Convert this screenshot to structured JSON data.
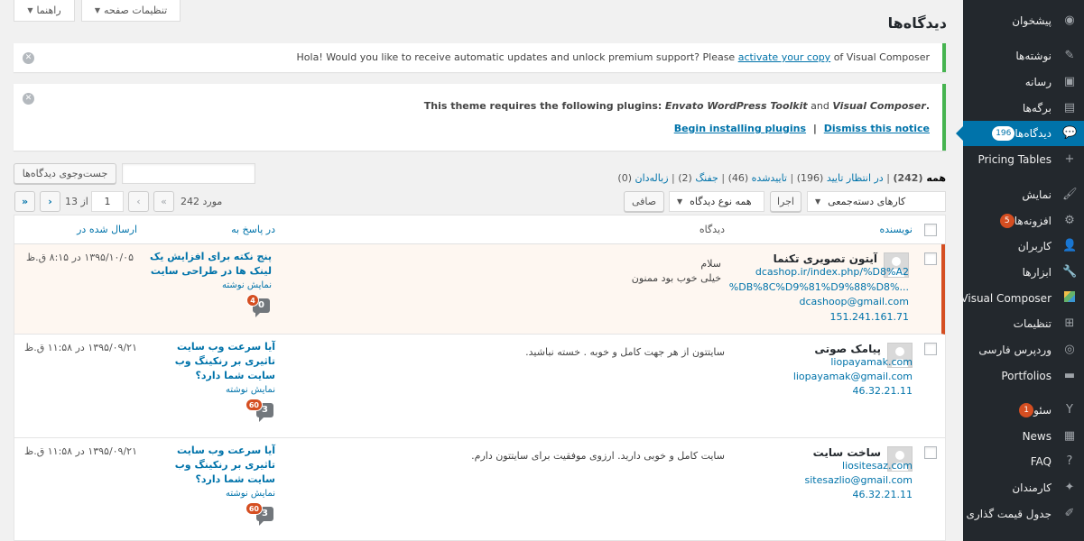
{
  "screen_tabs": {
    "options": "تنظیمات صفحه",
    "help": "راهنما"
  },
  "page_title": "دیدگاه‌ها",
  "sidebar": {
    "items": [
      {
        "label": "پیشخوان",
        "icon": "dashboard-icon",
        "glyph": "◉"
      },
      {
        "label": "نوشته‌ها",
        "icon": "pin-icon",
        "glyph": "✎"
      },
      {
        "label": "رسانه",
        "icon": "media-icon",
        "glyph": "▣"
      },
      {
        "label": "برگه‌ها",
        "icon": "pages-icon",
        "glyph": "▤"
      },
      {
        "label": "دیدگاه‌ها",
        "icon": "comments-icon",
        "glyph": "💬",
        "badge": "196",
        "current": true
      },
      {
        "label": "Pricing Tables",
        "icon": "pricing-table-icon",
        "glyph": "+"
      },
      {
        "label": "نمایش",
        "icon": "appearance-icon",
        "glyph": "🖌"
      },
      {
        "label": "افزونه‌ها",
        "icon": "plugins-icon",
        "glyph": "⚙",
        "badge": "5"
      },
      {
        "label": "کاربران",
        "icon": "users-icon",
        "glyph": "👤"
      },
      {
        "label": "ابزارها",
        "icon": "tools-icon",
        "glyph": "🔧"
      },
      {
        "label": "Visual Composer",
        "icon": "visual-composer-icon",
        "glyph": "vc"
      },
      {
        "label": "تنظیمات",
        "icon": "settings-icon",
        "glyph": "⊞"
      },
      {
        "label": "وردپرس فارسی",
        "icon": "wp-persian-icon",
        "glyph": "◎"
      },
      {
        "label": "Portfolios",
        "icon": "portfolio-icon",
        "glyph": "▬"
      },
      {
        "label": "سئو",
        "icon": "seo-icon",
        "glyph": "Y",
        "badge": "1"
      },
      {
        "label": "News",
        "icon": "news-icon",
        "glyph": "▦"
      },
      {
        "label": "FAQ",
        "icon": "faq-icon",
        "glyph": "?"
      },
      {
        "label": "کارمندان",
        "icon": "employees-icon",
        "glyph": "✦"
      },
      {
        "label": "جدول قیمت گذاری",
        "icon": "price-table-icon",
        "glyph": "✐"
      }
    ]
  },
  "notices": {
    "vc_before": "Hola! Would you like to receive automatic updates and unlock premium support? Please",
    "vc_link": "activate your copy",
    "vc_after": "of Visual Composer",
    "theme_prefix": "This theme requires the following plugins:",
    "theme_plugin1": "Envato WordPress Toolkit",
    "theme_and": "and",
    "theme_plugin2": "Visual Composer",
    "theme_suffix": ".",
    "begin_installing": "Begin installing plugins",
    "separator": "|",
    "dismiss": "Dismiss this notice"
  },
  "search": {
    "button": "جست‌وجوی دیدگاه‌ها",
    "value": ""
  },
  "filters": {
    "all_label": "همه",
    "all_count": "(242)",
    "pending_label": "در انتظار تایید",
    "pending_count": "(196)",
    "approved_label": "تاییدشده",
    "approved_count": "(46)",
    "spam_label": "جفنگ",
    "spam_count": "(2)",
    "trash_label": "زباله‌دان",
    "trash_count": "(0)",
    "sep": "|"
  },
  "bulk": {
    "bulk_select": "کارهای دسته‌جمعی",
    "apply": "اجرا",
    "type_select": "همه نوع دیدگاه",
    "filter_button": "صافی"
  },
  "pagination": {
    "items": "242 مورد",
    "first": "«",
    "prev": "‹",
    "current_page": "1",
    "of": "از 13",
    "next": "›",
    "last": "»"
  },
  "table": {
    "headers": {
      "author": "نویسنده",
      "comment": "دیدگاه",
      "in_response": "در پاسخ به",
      "submitted": "ارسال شده در"
    },
    "rows": [
      {
        "author": "آیتون تصویری تکنما",
        "url_line1": "dcashop.ir/index.php/%D8%A2",
        "url_line2": "%DB%8C%D9%81%D9%88%D8%...",
        "email": "dcashoop@gmail.com",
        "ip": "151.241.161.71",
        "comment_line1": "سلام",
        "comment_line2": "خیلی خوب بود ممنون",
        "post_title": "پنج نکته برای افزایش یک لینک ها در طراحی سایت",
        "view_post": "نمایش نوشته",
        "approved": "0",
        "pending": "4",
        "date": "۱۳۹۵/۱۰/۰۵ در ۸:۱۵ ق.ظ"
      },
      {
        "author": "پیامک صوتی",
        "url_line1": "liopayamak.com",
        "email": "liopayamak@gmail.com",
        "ip": "46.32.21.11",
        "comment_line1": "سایتتون از هر جهت کامل و خوبه . خسته نباشید.",
        "post_title": "آیا سرعت وب سایت تاثیری بر رنکینگ وب سایت شما دارد؟",
        "view_post": "نمایش نوشته",
        "approved": "3",
        "pending": "60",
        "date": "۱۳۹۵/۰۹/۲۱ در ۱۱:۵۸ ق.ظ"
      },
      {
        "author": "ساخت سایت",
        "url_line1": "liositesaz.com",
        "email": "sitesazlio@gmail.com",
        "ip": "46.32.21.11",
        "comment_line1": "سایت کامل و خوبی دارید. ارزوی موفقیت برای سایتتون دارم.",
        "post_title": "آیا سرعت وب سایت تاثیری بر رنکینگ وب سایت شما دارد؟",
        "view_post": "نمایش نوشته",
        "approved": "3",
        "pending": "60",
        "date": "۱۳۹۵/۰۹/۲۱ در ۱۱:۵۸ ق.ظ"
      }
    ]
  },
  "colors": {
    "accent": "#0073aa",
    "sidebar": "#23282d",
    "badge": "#d54e21",
    "notice_border": "#46b450"
  }
}
